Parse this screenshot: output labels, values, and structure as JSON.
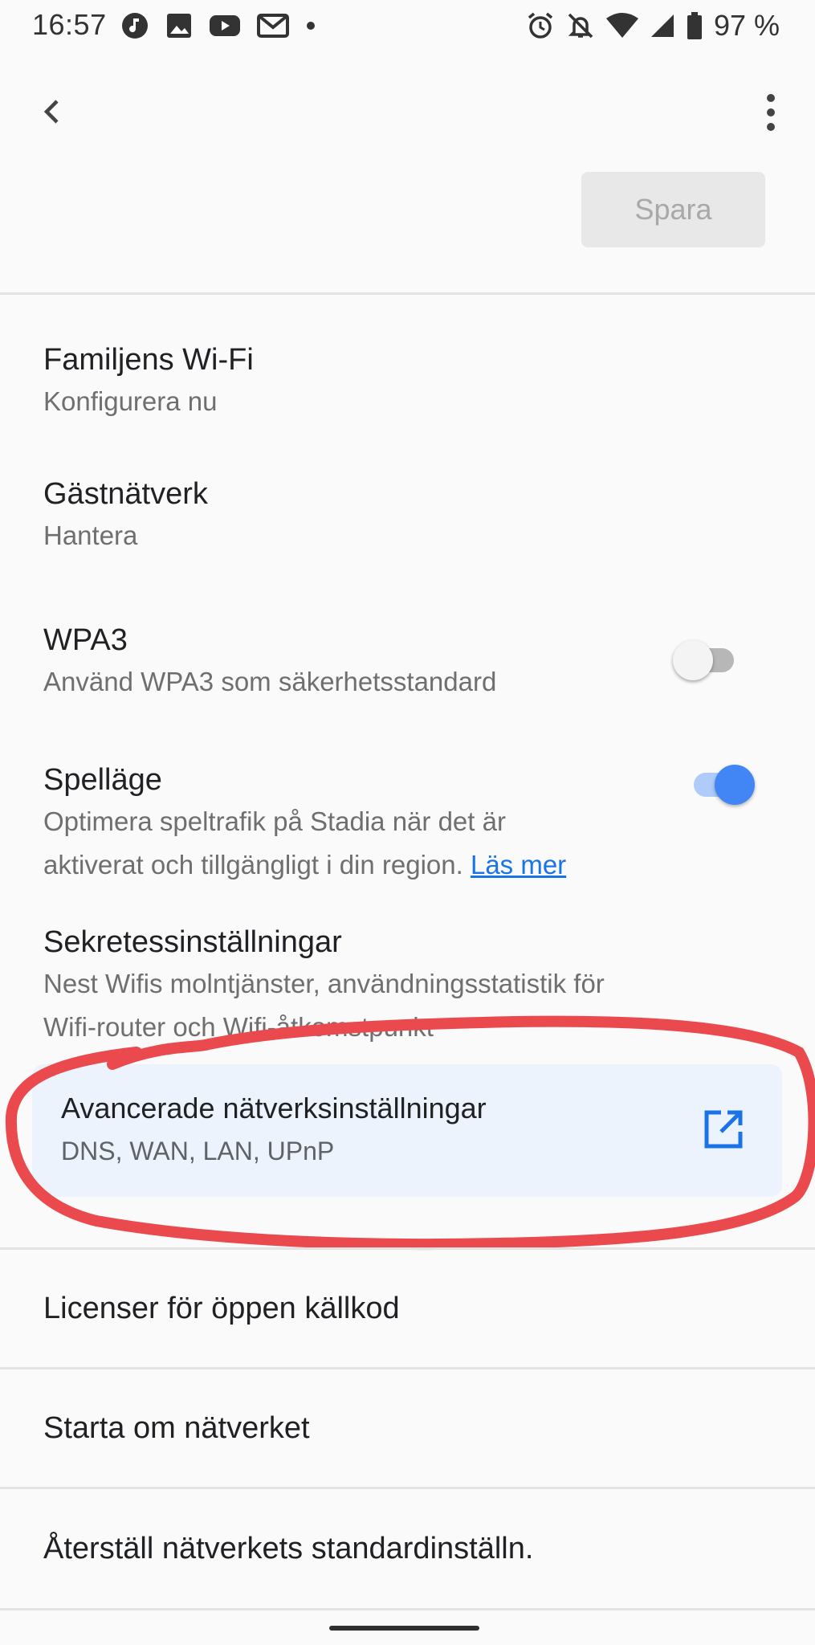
{
  "status_bar": {
    "time": "16:57",
    "battery_text": "97 %",
    "left_icons": [
      "music-note-icon",
      "image-icon",
      "youtube-icon",
      "gmail-icon",
      "dot-icon"
    ],
    "right_icons": [
      "alarm-icon",
      "notifications-off-icon",
      "wifi-icon",
      "signal-icon",
      "battery-icon"
    ]
  },
  "toolbar": {
    "back_icon": "back-arrow-icon",
    "menu_icon": "more-vert-icon",
    "save_label": "Spara"
  },
  "settings": {
    "family_wifi": {
      "title": "Familjens Wi-Fi",
      "subtitle": "Konfigurera nu"
    },
    "guest_network": {
      "title": "Gästnätverk",
      "subtitle": "Hantera"
    },
    "wpa3": {
      "title": "WPA3",
      "subtitle": "Använd WPA3 som säkerhetsstandard",
      "enabled": false
    },
    "game_mode": {
      "title": "Spelläge",
      "subtitle_line1": "Optimera speltrafik på Stadia när det är",
      "subtitle_line2": "aktiverat och tillgängligt i din region.",
      "learn_more": "Läs mer",
      "enabled": true
    },
    "privacy": {
      "title": "Sekretessinställningar",
      "subtitle_line1": "Nest Wifis molntjänster, användningsstatistik för",
      "subtitle_line2": "Wifi-router och Wifi-åtkomstpunkt"
    },
    "advanced": {
      "title": "Avancerade nätverksinställningar",
      "subtitle": "DNS, WAN, LAN, UPnP",
      "icon": "open-in-new-icon"
    },
    "licenses": {
      "title": "Licenser för öppen källkod"
    },
    "restart": {
      "title": "Starta om nätverket"
    },
    "reset": {
      "title": "Återställ nätverkets standardinställn."
    }
  },
  "colors": {
    "accent": "#4285f4",
    "link": "#1a73e8",
    "card_background": "#ecf3fd",
    "annotation_stroke": "#ea4a4e"
  }
}
